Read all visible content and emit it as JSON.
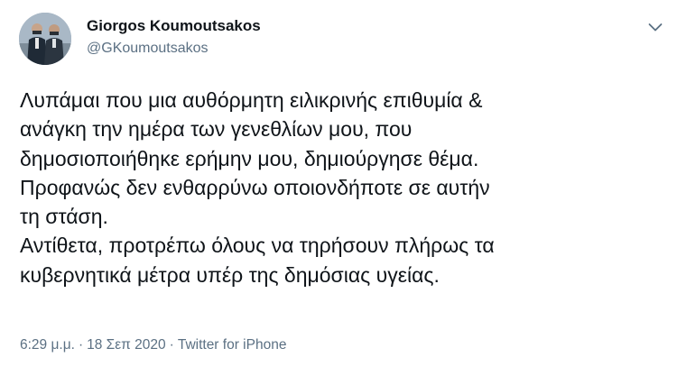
{
  "author": {
    "display_name": "Giorgos Koumoutsakos",
    "handle": "@GKoumoutsakos",
    "avatar_icon": "profile-photo"
  },
  "menu": {
    "icon": "chevron-down-icon"
  },
  "tweet": {
    "lines": [
      "Λυπάμαι που μια αυθόρμητη ειλικρινής επιθυμία &",
      "ανάγκη την ημέρα των γενεθλίων μου, που",
      "δημοσιοποιήθηκε ερήμην μου, δημιούργησε θέμα.",
      "Προφανώς δεν ενθαρρύνω οποιονδήποτε σε αυτήν",
      "τη στάση.",
      "Αντίθετα, προτρέπω όλους να τηρήσουν πλήρως τα",
      "κυβερνητικά μέτρα υπέρ της δημόσιας υγείας."
    ]
  },
  "meta": {
    "time": "6:29 μ.μ.",
    "date": "18 Σεπ 2020",
    "source": "Twitter for iPhone",
    "separator": "·"
  },
  "colors": {
    "text": "#0f1419",
    "secondary": "#5b7083",
    "background": "#ffffff"
  }
}
